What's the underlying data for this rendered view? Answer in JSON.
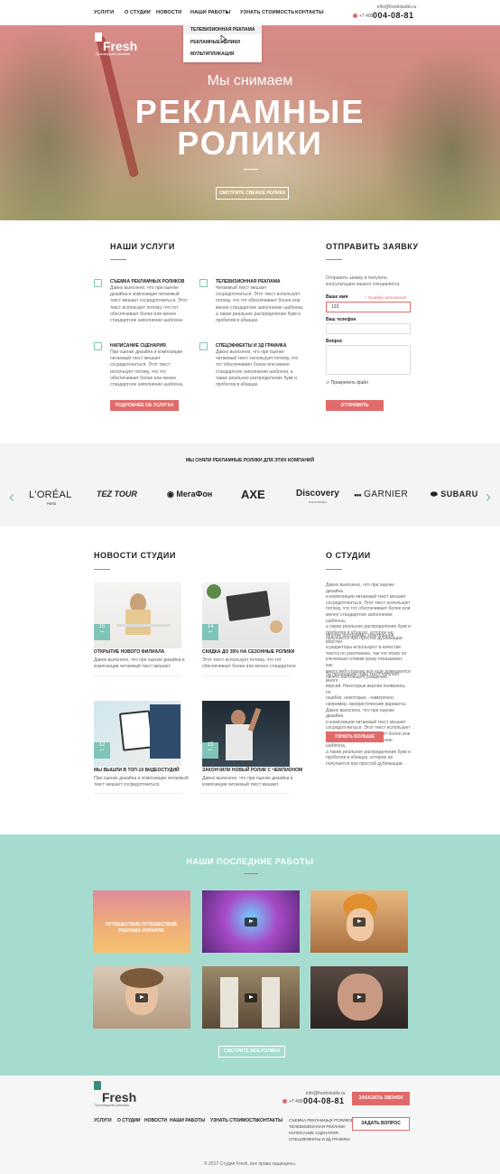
{
  "nav": {
    "items": [
      "УСЛУГИ",
      "О СТУДИИ",
      "НОВОСТИ",
      "НАШИ РАБОТЫ",
      "УЗНАТЬ СТОИМОСТЬ",
      "КОНТАКТЫ"
    ],
    "dropdown_arrow": "▾",
    "dropdown": [
      "ТЕЛЕВИЗИОННАЯ РЕКЛАМА",
      "РЕКЛАМНЫЕ РОЛИКИ",
      "МУЛЬТИПЛИКАЦИЯ"
    ],
    "email": "info@freshstudio.ru",
    "phone_prefix": "+7 495",
    "phone": "004-08-81"
  },
  "hero": {
    "logo": "Fresh",
    "logo_sub": "Производство рекламы",
    "subtitle": "Мы снимаем",
    "title_line1": "РЕКЛАМНЫЕ",
    "title_line2": "РОЛИКИ",
    "button": "СМОТРИТЕ СВЕЖИЕ РОЛИКИ"
  },
  "services": {
    "title": "НАШИ УСЛУГИ",
    "items": [
      {
        "title": "СЪЕМКА РЕКЛАМНЫХ РОЛИКОВ",
        "text": [
          "Давно выяснено, что при оценке",
          "дизайна и композиции читаемый",
          "текст мешает сосредоточиться. Этот",
          "текст использует потому, что тот",
          "обеспечивает более или менее",
          "стандартное заполнение шаблона"
        ]
      },
      {
        "title": "ТЕЛЕВИЗИОННАЯ РЕКЛАМА",
        "text": [
          "Читаемый текст мешает",
          "сосредоточиться. Этот текст использует",
          "потому, что тот обеспечивает более или",
          "менее стандартное заполнение шаблона,",
          "а также реальное распределение букв и",
          "пробелов в абзацах."
        ]
      },
      {
        "title": "НАПИСАНИЕ СЦЕНАРИЯ",
        "text": [
          "При оценке дизайна и композиции",
          "читаемый текст мешает",
          "сосредоточиться. Этот текст",
          "использует потому, что тот",
          "обеспечивает более или менее",
          "стандартное заполнение шаблона."
        ]
      },
      {
        "title": "СПЕЦЭФФЕКТЫ И 3Д ГРАФИКА",
        "text": [
          "Давно выяснено, что при оценке",
          "читаемый текст использует потому, что",
          "тот обеспечивает более или менее",
          "стандартное заполнение шаблона, а",
          "также реальное распределение букв и",
          "пробелов в абзацах."
        ]
      }
    ],
    "button": "ПОДРОБНЕЕ ОБ УСЛУГАХ"
  },
  "form": {
    "title": "ОТПРАВИТЬ ЗАЯВКУ",
    "intro": [
      "Отправить заявку и получить",
      "консультацию нашего специалиста"
    ],
    "name_label": "Ваше имя",
    "error": "Ошибка заполнения",
    "name_value": "123",
    "phone_label": "Ваш телефон",
    "question_label": "Вопрос",
    "attach": "Прикрепить файл",
    "submit": "ОТПРАВИТЬ"
  },
  "clients": {
    "title": "МЫ СНЯЛИ РЕКЛАМНЫЕ РОЛИКИ ДЛЯ ЭТИХ КОМПАНИЙ",
    "brands": [
      "L'ORÉAL",
      "TEZ TOUR",
      "МегаФон",
      "AXE",
      "Discovery",
      "GARNIER",
      "SUBARU"
    ],
    "loreal_sub": "PARIS",
    "discovery_sub": "CHANNEL",
    "prev": "‹",
    "next": "›"
  },
  "news": {
    "title": "НОВОСТИ СТУДИИ",
    "items": [
      {
        "day": "15",
        "month": "дек",
        "title": "ОТКРЫТИЕ НОВОГО ФИЛИАЛА",
        "text": [
          "Давно выяснено, что при оценке дизайна и",
          "композиции читаемый текст мешает."
        ]
      },
      {
        "day": "14",
        "month": "дек",
        "title": "СКИДКА ДО 35% НА СЕЗОННЫЕ РОЛИКИ",
        "text": [
          "Этот текст использует потому, что тот",
          "обеспечивает более или менее стандартное"
        ]
      },
      {
        "day": "12",
        "month": "дек",
        "title": "МЫ ВЫШЛИ В ТОП-10 ВИДЕОСТУДИЙ",
        "text": [
          "При оценке дизайна и композиции читаемый",
          "текст мешает сосредоточиться."
        ]
      },
      {
        "day": "15",
        "month": "дек",
        "title": "ЗАКОНЧИЛИ НОВЫЙ РОЛИК С ЧЕМПИОНОМ",
        "text": [
          "Давно выяснено, что при оценке дизайна и",
          "композиции читаемый текст мешает."
        ]
      }
    ]
  },
  "about": {
    "title": "О СТУДИИ",
    "p1": [
      "Давно выяснено, что при оценке дизайна",
      "и композиции читаемый текст мешает",
      "сосредоточиться. Этот текст использует",
      "потому, что тот обеспечивает более или",
      "менее стандартное заполнение шаблона,",
      "а также реальное распределение букв и",
      "пробелов в абзацах, которое не",
      "получается при простой дубликации."
    ],
    "p2": [
      "Многие программы электронной вёрстки",
      "и редакторы используют в качестве",
      "текста по умолчанию, так что поиск по",
      "ключевым словам сразу показывает, как",
      "много веб-страниц всё ещё дожидаются",
      "своего настоящего рождения."
    ],
    "p3": [
      "За прошедшие годы текст получил много",
      "версий. Некоторые версии появились по",
      "ошибке, некоторые - намеренно,",
      "например, юмористические варианты.",
      "Давно выяснено, что при оценке дизайна",
      "и композиции читаемый текст мешает",
      "сосредоточиться. Этот текст использует",
      "потому, что тот обеспечивает более или",
      "менее стандартное заполнение шаблона,",
      "а также реальное распределение букв и",
      "пробелов в абзацах, которое не",
      "получается при простой дубликации."
    ],
    "button": "УЗНАТЬ БОЛЬШЕ"
  },
  "works": {
    "title": "НАШИ ПОСЛЕДНИЕ РАБОТЫ",
    "first_caption1": "ПУТЕШЕСТВИЕ ПУТЕШЕСТВИЙ.",
    "first_caption2": "РЕКЛАМА ИЗРАИЛЯ.",
    "button": "СМОТРИТЕ ВСЕ РОЛИКИ"
  },
  "footer": {
    "logo": "Fresh",
    "logo_sub": "Производство рекламы",
    "email": "info@freshstudio.ru",
    "phone_prefix": "+7 495",
    "phone": "004-08-81",
    "links": [
      "УСЛУГИ",
      "О СТУДИИ",
      "НОВОСТИ",
      "НАШИ РАБОТЫ",
      "УЗНАТЬ СТОИМОСТЬ",
      "КОНТАКТЫ"
    ],
    "sub_links": [
      "СЪЕМКА РЕКЛАМНЫХ РОЛИКОВ",
      "ТЕЛЕВИЗИОННАЯ РЕКЛАМА",
      "НАПИСАНИЕ СЦЕНАРИЯ",
      "СПЕЦЭФФЕКТЫ И 3Д ГРАФИКА"
    ],
    "call_button": "ЗАКАЗАТЬ ЗВОНОК",
    "question_button": "ЗАДАТЬ ВОПРОС",
    "copyright": "© 2017 Студия Fresh, все права защищены."
  },
  "colors": {
    "accent": "#e06a6a",
    "teal": "#7fc4b8",
    "works_bg": "#a6dccf"
  }
}
